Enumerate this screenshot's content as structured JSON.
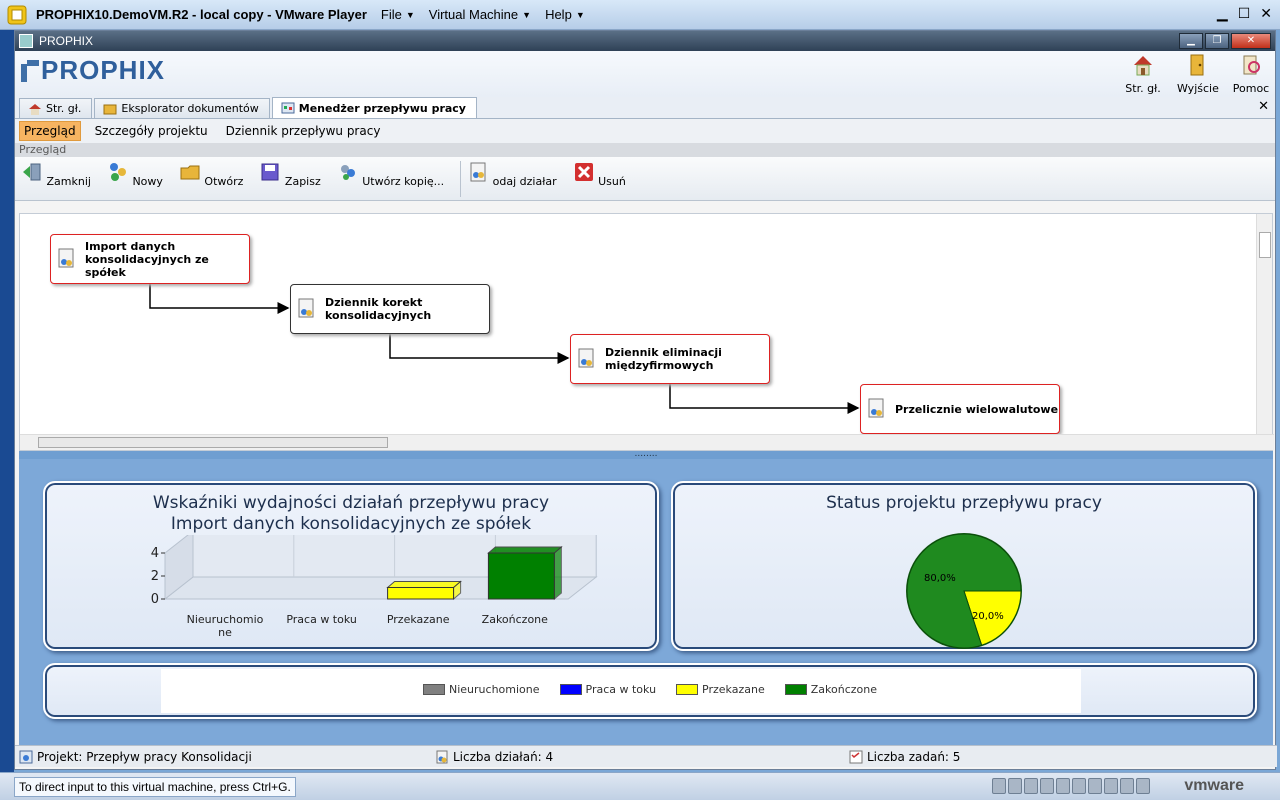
{
  "vm": {
    "title": "PROPHIX10.DemoVM.R2 - local copy - VMware Player",
    "menus": [
      "File",
      "Virtual Machine",
      "Help"
    ],
    "hint": "To direct input to this virtual machine, press Ctrl+G.",
    "brand": "vmware"
  },
  "app": {
    "title": "PROPHIX",
    "brand": "PROPHIX",
    "actions": [
      "Str. gł.",
      "Wyjście",
      "Pomoc"
    ]
  },
  "tabs": [
    "Str. gł.",
    "Eksplorator dokumentów",
    "Menedżer przepływu pracy"
  ],
  "subnav": [
    "Przegląd",
    "Szczegóły projektu",
    "Dziennik przepływu pracy"
  ],
  "breadcrumb": "Przegląd",
  "toolbar": [
    "Zamknij",
    "Nowy",
    "Otwórz",
    "Zapisz",
    "Utwórz kopię...",
    "odaj działar",
    "Usuń"
  ],
  "flow": {
    "nodes": [
      {
        "text": "Import danych konsolidacyjnych ze spółek",
        "status": "red"
      },
      {
        "text": "Dziennik korekt konsolidacyjnych",
        "status": "black"
      },
      {
        "text": "Dziennik eliminacji międzyfirmowych",
        "status": "red"
      },
      {
        "text": "Przelicznie wielowalutowe",
        "status": "red"
      }
    ],
    "splitter": "........"
  },
  "kpi": {
    "title_line1": "Wskaźniki wydajności działań przepływu pracy",
    "title_line2": "Import danych konsolidacyjnych ze spółek",
    "chart_data": {
      "type": "bar",
      "categories": [
        "Nieuruchomione",
        "Praca w toku",
        "Przekazane",
        "Zakończone"
      ],
      "category_labels": [
        "Nieuruchomio ne",
        "Praca w toku",
        "Przekazane",
        "Zakończone"
      ],
      "values": [
        0,
        0,
        1,
        4
      ],
      "ytick_labels": [
        "0",
        "2",
        "4"
      ],
      "colors": [
        "#808080",
        "#0000ff",
        "#ffff00",
        "#008000"
      ],
      "ylim": [
        0,
        4
      ],
      "title": "Wskaźniki wydajności działań przepływu pracy\nImport danych konsolidacyjnych ze spółek"
    }
  },
  "status_chart": {
    "title": "Status projektu przepływu pracy",
    "chart_data": {
      "type": "pie",
      "categories": [
        "Zakończone",
        "Przekazane"
      ],
      "values": [
        80.0,
        20.0
      ],
      "labels": [
        "80,0%",
        "20,0%"
      ],
      "colors": [
        "#1f8a1f",
        "#ffff00"
      ],
      "title": "Status projektu przepływu pracy"
    }
  },
  "legend": [
    {
      "label": "Nieuruchomione",
      "color": "#808080"
    },
    {
      "label": "Praca w toku",
      "color": "#0000ff"
    },
    {
      "label": "Przekazane",
      "color": "#ffff00"
    },
    {
      "label": "Zakończone",
      "color": "#008000"
    }
  ],
  "status": {
    "project": "Projekt: Przepływ pracy Konsolidacji",
    "activities": "Liczba działań: 4",
    "tasks": "Liczba zadań: 5"
  }
}
